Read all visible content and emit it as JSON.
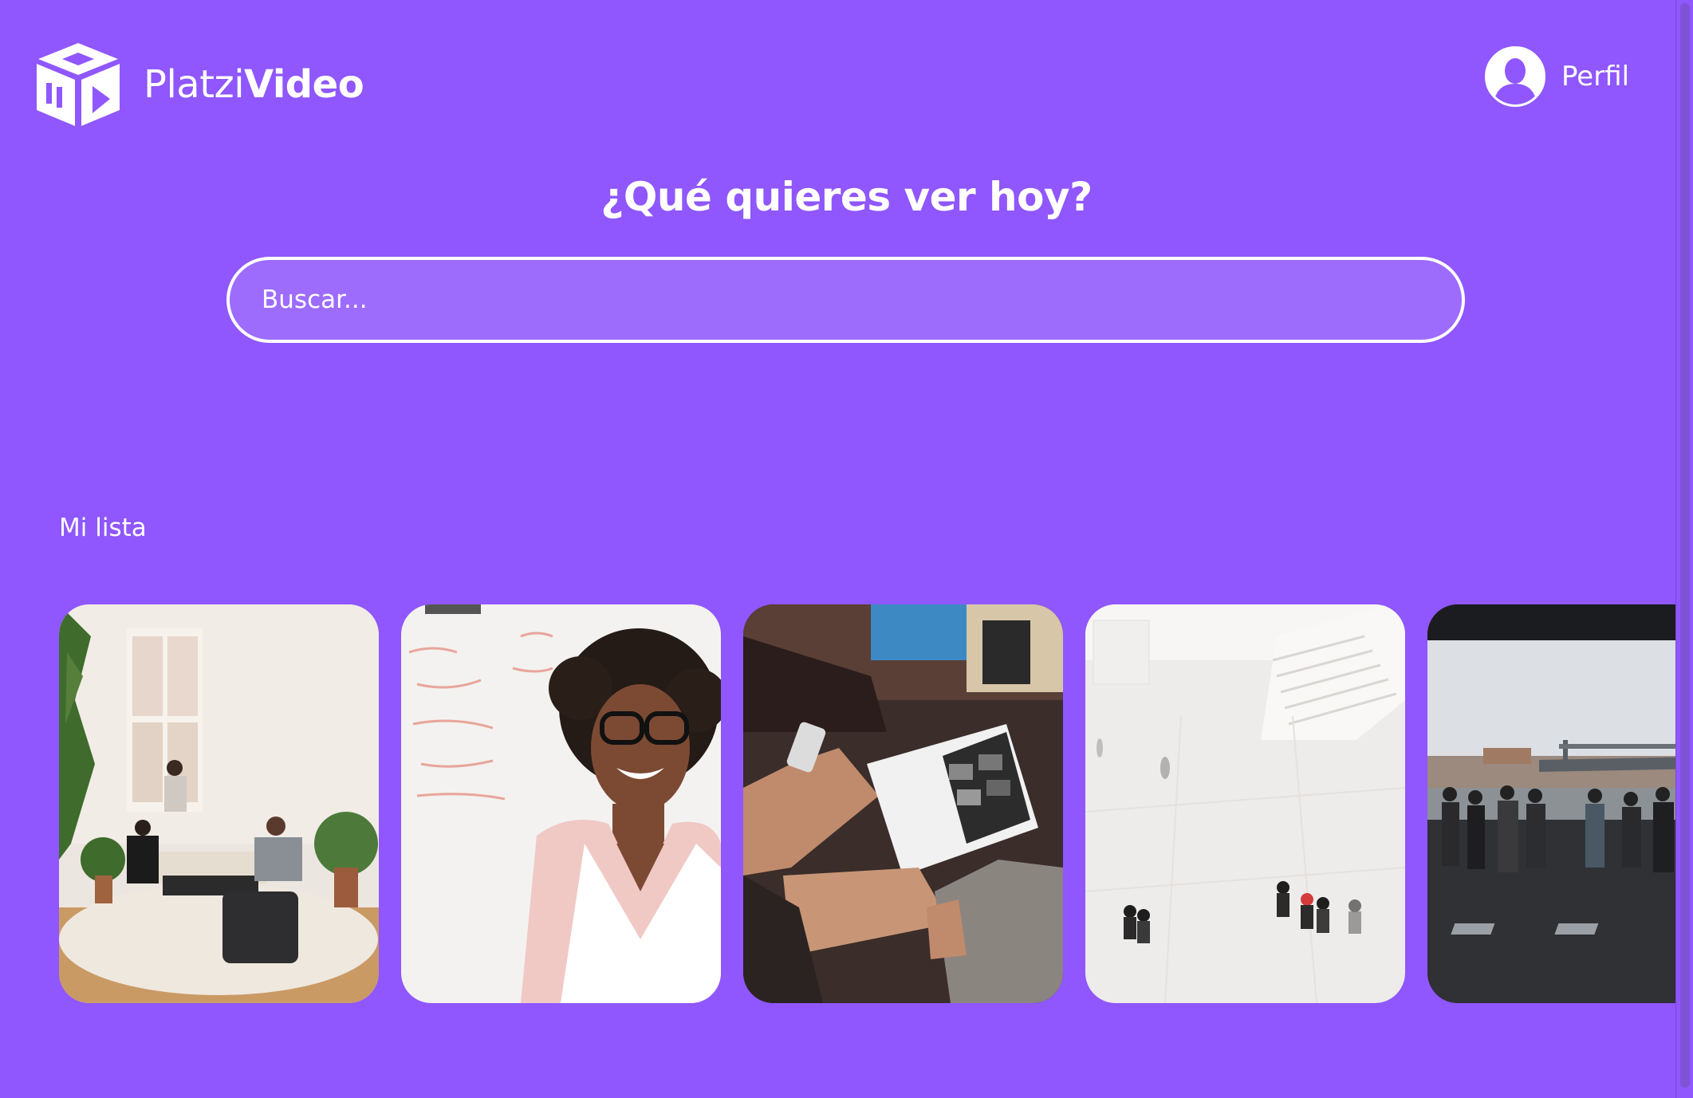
{
  "app": {
    "logo_light": "Platzi",
    "logo_bold": "Video",
    "logo_icon": "cube-video-icon"
  },
  "header": {
    "profile_label": "Perfil",
    "profile_icon": "user-avatar-icon"
  },
  "hero": {
    "title": "¿Qué quieres ver hoy?",
    "search_placeholder": "Buscar...",
    "search_value": ""
  },
  "my_list": {
    "title": "Mi lista",
    "items": [
      {
        "scene": "living-room-friends"
      },
      {
        "scene": "smiling-woman-glasses"
      },
      {
        "scene": "people-reading-magazine"
      },
      {
        "scene": "people-walking-white-plaza"
      },
      {
        "scene": "people-watching-harbor"
      }
    ]
  },
  "colors": {
    "background": "#8f57fd",
    "text": "#ffffff"
  }
}
